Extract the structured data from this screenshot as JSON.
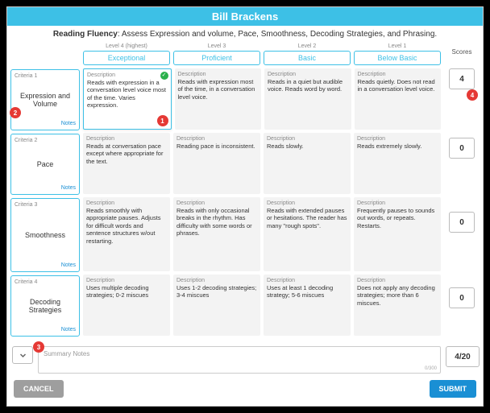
{
  "title": "Bill Brackens",
  "subtitle_bold": "Reading Fluency",
  "subtitle_rest": ": Assess Expression and volume, Pace, Smoothness, Decoding Strategies, and Phrasing.",
  "levels": [
    {
      "small": "Level 4 (highest)",
      "label": "Exceptional"
    },
    {
      "small": "Level 3",
      "label": "Proficient"
    },
    {
      "small": "Level 2",
      "label": "Basic"
    },
    {
      "small": "Level 1",
      "label": "Below Basic"
    }
  ],
  "criteria": [
    {
      "small": "Criteria 1",
      "name": "Expression and Volume",
      "notes": "Notes"
    },
    {
      "small": "Criteria 2",
      "name": "Pace",
      "notes": "Notes"
    },
    {
      "small": "Criteria 3",
      "name": "Smoothness",
      "notes": "Notes"
    },
    {
      "small": "Criteria 4",
      "name": "Decoding Strategies",
      "notes": "Notes"
    }
  ],
  "desc_label": "Description",
  "grid": [
    [
      "Reads with expression in a conversation level voice most of the time. Varies expression.",
      "Reads with expression most of the time, in a conversation level voice.",
      "Reads in a quiet but audible voice. Reads word by word.",
      "Reads quietly. Does not read in a conversation level voice."
    ],
    [
      "Reads at conversation pace except where appropriate for the text.",
      "Reading pace is inconsistent.",
      "Reads slowly.",
      "Reads extremely slowly."
    ],
    [
      "Reads smoothly with appropriate pauses. Adjusts for difficult words and sentence structures w/out restarting.",
      "Reads with only occasional breaks in the rhythm. Has difficulty with some words or phrases.",
      "Reads with extended pauses or hesitations. The reader has many \"rough spots\".",
      "Frequently pauses to sounds out words, or repeats. Restarts."
    ],
    [
      "Uses multiple decoding strategies; 0-2 miscues",
      "Uses 1-2 decoding strategies; 3-4 miscues",
      "Uses at least 1 decoding strategy; 5-6 miscues",
      "Does not apply any decoding strategies; more than 6 miscues."
    ]
  ],
  "scores_header": "Scores",
  "scores": [
    "4",
    "0",
    "0",
    "0"
  ],
  "summary_placeholder": "Summary Notes",
  "summary_count": "0/300",
  "total": "4/20",
  "cancel": "CANCEL",
  "submit": "SUBMIT",
  "badges": {
    "b1": "1",
    "b2": "2",
    "b3": "3",
    "b4": "4"
  }
}
